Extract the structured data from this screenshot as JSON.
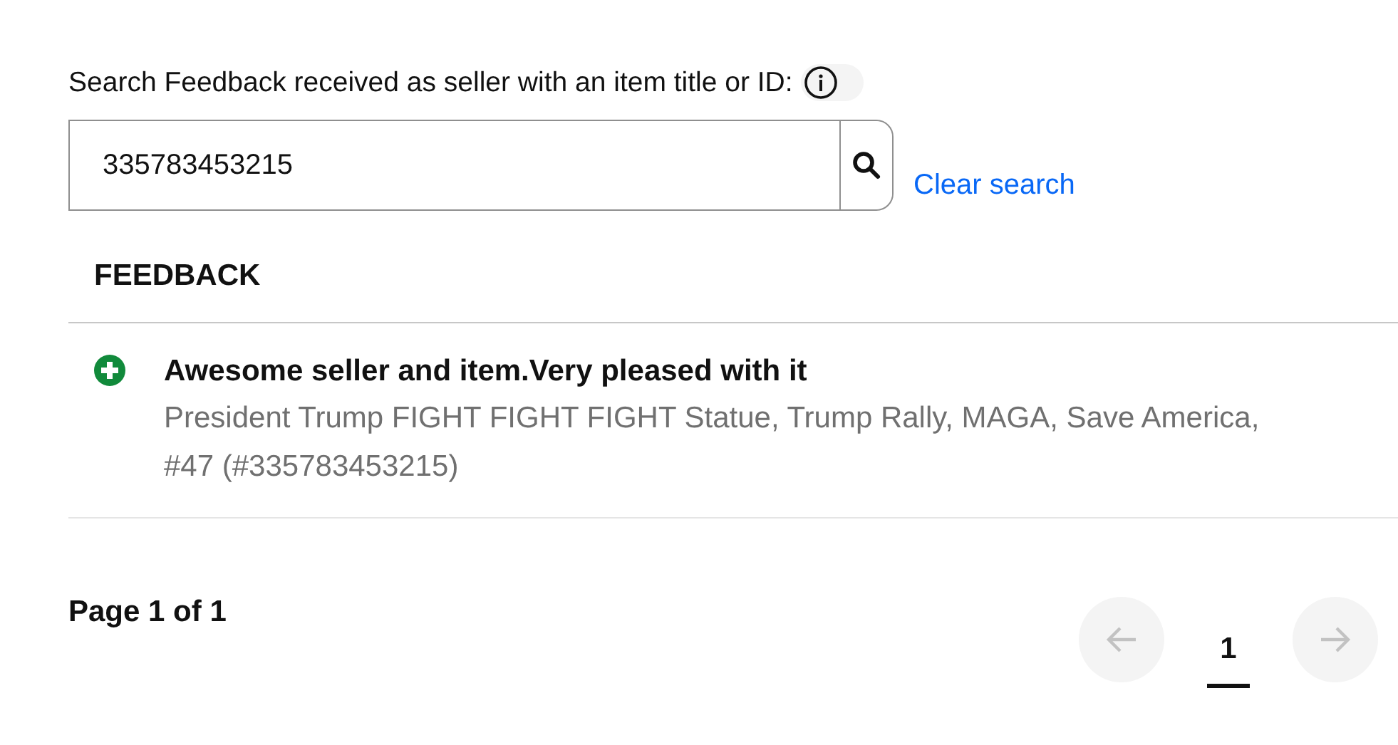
{
  "search": {
    "label": "Search Feedback received as seller with an item title or ID:",
    "value": "335783453215",
    "clear_link": "Clear search"
  },
  "table": {
    "heading": "FEEDBACK",
    "rows": [
      {
        "kind": "positive",
        "comment": "Awesome seller and item.Very pleased with it",
        "item": "President Trump FIGHT FIGHT FIGHT Statue, Trump Rally, MAGA, Save America, #47 (#335783453215)"
      }
    ]
  },
  "pagination": {
    "summary": "Page 1 of 1",
    "prev_disabled": true,
    "next_disabled": true,
    "pages": [
      {
        "label": "1",
        "selected": true
      }
    ]
  }
}
